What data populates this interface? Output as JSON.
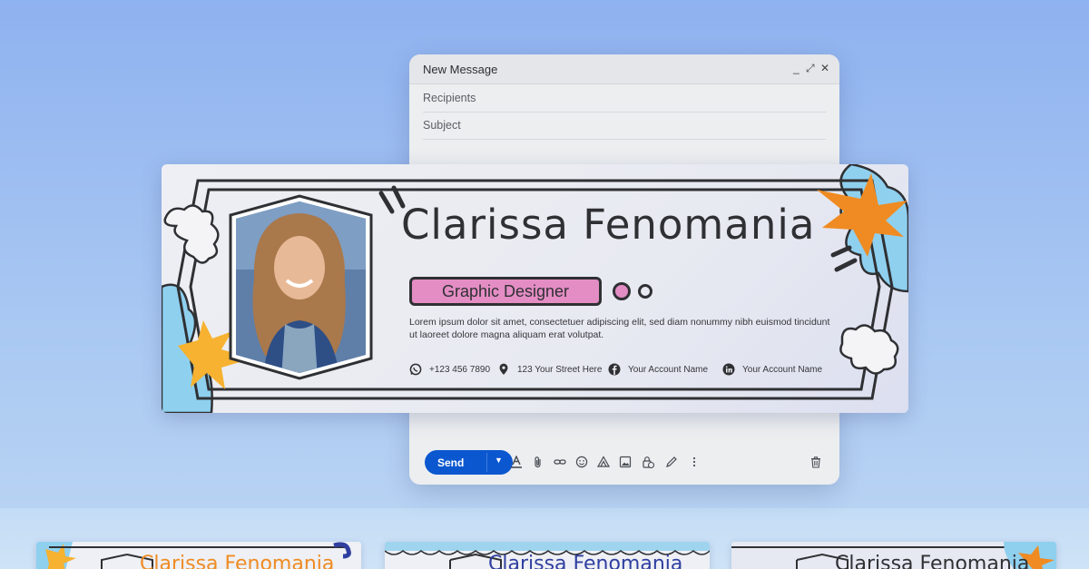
{
  "compose": {
    "title": "New Message",
    "controls": {
      "minimize": "_",
      "expand": "⤢",
      "close": "✕"
    },
    "recipients_placeholder": "Recipients",
    "subject_placeholder": "Subject",
    "send_label": "Send",
    "toolbar_icons": [
      "format-text-icon",
      "attach-icon",
      "link-icon",
      "emoji-icon",
      "drive-icon",
      "image-icon",
      "lock-clock-icon",
      "pen-icon",
      "more-icon",
      "trash-icon"
    ]
  },
  "signature": {
    "name": "Clarissa Fenomania",
    "job_title": "Graphic Designer",
    "bio": "Lorem ipsum dolor sit amet, consectetuer adipiscing elit, sed diam nonummy nibh euismod tincidunt ut laoreet dolore magna aliquam erat volutpat.",
    "contacts": [
      {
        "icon": "whatsapp-icon",
        "text": "+123 456 7890"
      },
      {
        "icon": "location-pin-icon",
        "text": "123 Your Street Here"
      },
      {
        "icon": "facebook-icon",
        "text": "Your Account Name"
      },
      {
        "icon": "linkedin-icon",
        "text": "Your Account Name"
      }
    ],
    "colors": {
      "pink": "#e48dc4",
      "ink": "#2f3033",
      "orange": "#ef8b22",
      "blue": "#7cc4ea"
    }
  },
  "thumbnails": [
    {
      "name": "Clarissa Fenomania",
      "color": "#ef8b22"
    },
    {
      "name": "Clarissa Fenomania",
      "color": "#2f3fa0"
    },
    {
      "name": "Clarissa Fenomania",
      "color": "#2f3033"
    }
  ]
}
